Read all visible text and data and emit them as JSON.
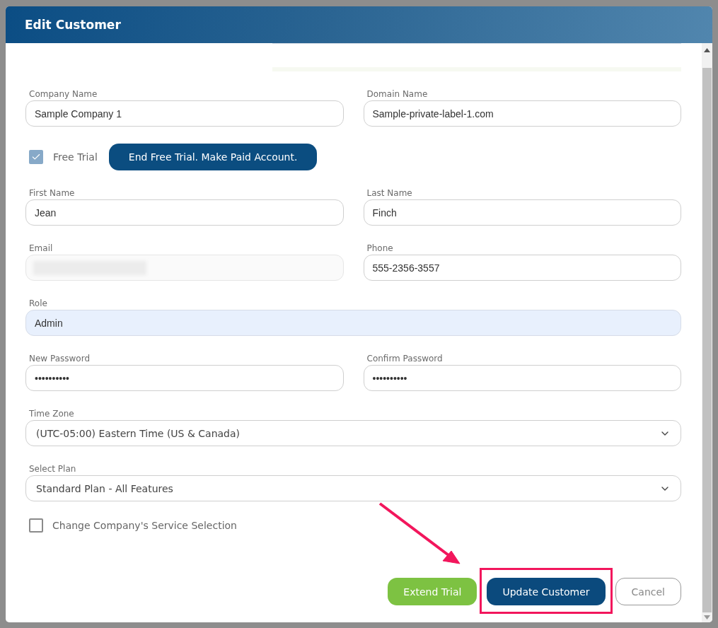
{
  "dialog": {
    "title": "Edit Customer"
  },
  "form": [
    {
      "kind": "pair",
      "fields": [
        {
          "kind": "text",
          "label": "Company Name",
          "value": "Sample Company 1"
        },
        {
          "kind": "text",
          "label": "Domain Name",
          "value": "Sample-private-label-1.com"
        }
      ]
    },
    {
      "kind": "trial",
      "label": "Free Trial",
      "checked": true,
      "button": "End Free Trial. Make Paid Account."
    },
    {
      "kind": "pair",
      "fields": [
        {
          "kind": "text",
          "label": "First Name",
          "value": "Jean"
        },
        {
          "kind": "text",
          "label": "Last Name",
          "value": "Finch"
        }
      ]
    },
    {
      "kind": "pair",
      "fields": [
        {
          "kind": "redacted",
          "label": "Email"
        },
        {
          "kind": "text",
          "label": "Phone",
          "value": "555-2356-3557"
        }
      ]
    },
    {
      "kind": "full",
      "field": {
        "kind": "readonly",
        "label": "Role",
        "value": "Admin"
      }
    },
    {
      "kind": "pair",
      "fields": [
        {
          "kind": "password",
          "label": "New Password",
          "value": "••••••••••"
        },
        {
          "kind": "password",
          "label": "Confirm Password",
          "value": "••••••••••"
        }
      ]
    },
    {
      "kind": "full",
      "field": {
        "kind": "select",
        "label": "Time Zone",
        "value": "(UTC-05:00) Eastern Time (US & Canada)"
      }
    },
    {
      "kind": "full",
      "field": {
        "kind": "select",
        "label": "Select Plan",
        "value": "Standard Plan - All Features"
      }
    },
    {
      "kind": "check",
      "label": "Change Company's Service Selection",
      "checked": false
    }
  ],
  "footer_buttons": [
    {
      "kind": "success",
      "label": "Extend Trial",
      "highlighted": false
    },
    {
      "kind": "primary",
      "label": "Update Customer",
      "highlighted": true
    },
    {
      "kind": "outline",
      "label": "Cancel",
      "highlighted": false
    }
  ]
}
